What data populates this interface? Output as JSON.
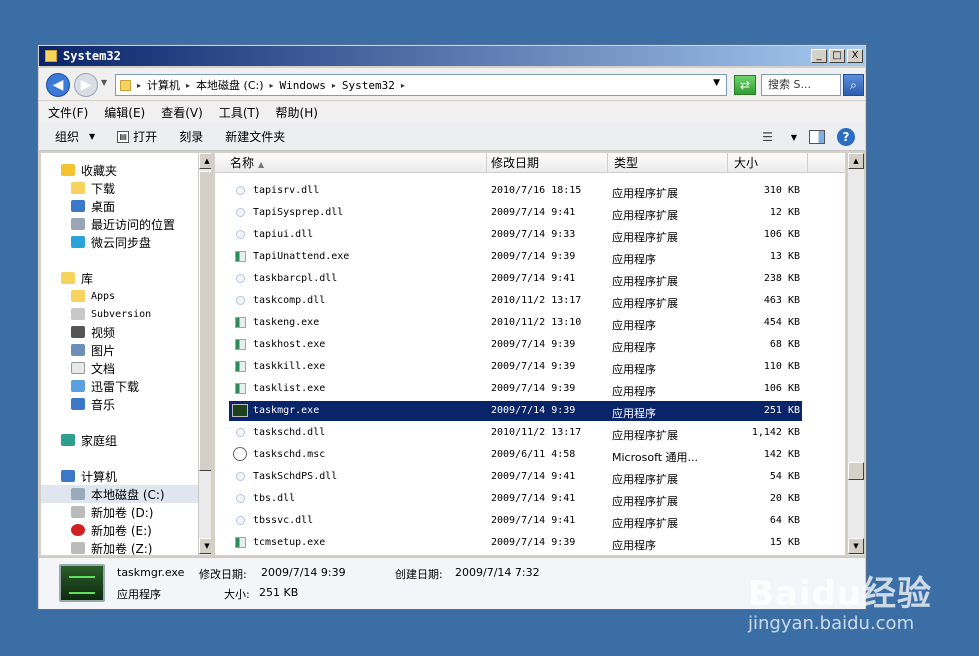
{
  "window": {
    "title": "System32",
    "minimize": "_",
    "maximize": "□",
    "close": "X"
  },
  "address": {
    "breadcrumbs": [
      "计算机",
      "本地磁盘 (C:)",
      "Windows",
      "System32"
    ],
    "search_placeholder": "搜索 S..."
  },
  "menu": [
    "文件(F)",
    "编辑(E)",
    "查看(V)",
    "工具(T)",
    "帮助(H)"
  ],
  "toolbar": {
    "organize": "组织",
    "open": "打开",
    "burn": "刻录",
    "new_folder": "新建文件夹"
  },
  "nav": {
    "favorites": "收藏夹",
    "downloads": "下载",
    "desktop": "桌面",
    "recent": "最近访问的位置",
    "weiyun": "微云同步盘",
    "libraries": "库",
    "apps": "Apps",
    "subversion": "Subversion",
    "videos": "视频",
    "pictures": "图片",
    "documents": "文档",
    "xunlei": "迅雷下载",
    "music": "音乐",
    "homegroup": "家庭组",
    "computer": "计算机",
    "drive_c": "本地磁盘 (C:)",
    "drive_d": "新加卷 (D:)",
    "drive_e": "新加卷 (E:)",
    "drive_z": "新加卷 (Z:)"
  },
  "columns": {
    "name": "名称",
    "date": "修改日期",
    "type": "类型",
    "size": "大小"
  },
  "files": [
    {
      "name": "tapisrv.dll",
      "date": "2010/7/16 18:15",
      "type": "应用程序扩展",
      "size": "310 KB",
      "icon": "dll-icon"
    },
    {
      "name": "TapiSysprep.dll",
      "date": "2009/7/14 9:41",
      "type": "应用程序扩展",
      "size": "12 KB",
      "icon": "dll-icon"
    },
    {
      "name": "tapiui.dll",
      "date": "2009/7/14 9:33",
      "type": "应用程序扩展",
      "size": "106 KB",
      "icon": "dll-icon"
    },
    {
      "name": "TapiUnattend.exe",
      "date": "2009/7/14 9:39",
      "type": "应用程序",
      "size": "13 KB",
      "icon": "exe-icon"
    },
    {
      "name": "taskbarcpl.dll",
      "date": "2009/7/14 9:41",
      "type": "应用程序扩展",
      "size": "238 KB",
      "icon": "dll-icon"
    },
    {
      "name": "taskcomp.dll",
      "date": "2010/11/2 13:17",
      "type": "应用程序扩展",
      "size": "463 KB",
      "icon": "dll-icon"
    },
    {
      "name": "taskeng.exe",
      "date": "2010/11/2 13:10",
      "type": "应用程序",
      "size": "454 KB",
      "icon": "exe-icon"
    },
    {
      "name": "taskhost.exe",
      "date": "2009/7/14 9:39",
      "type": "应用程序",
      "size": "68 KB",
      "icon": "exe-icon"
    },
    {
      "name": "taskkill.exe",
      "date": "2009/7/14 9:39",
      "type": "应用程序",
      "size": "110 KB",
      "icon": "exe-icon"
    },
    {
      "name": "tasklist.exe",
      "date": "2009/7/14 9:39",
      "type": "应用程序",
      "size": "106 KB",
      "icon": "exe-icon"
    },
    {
      "name": "taskmgr.exe",
      "date": "2009/7/14 9:39",
      "type": "应用程序",
      "size": "251 KB",
      "icon": "taskmgr-icon",
      "selected": true
    },
    {
      "name": "taskschd.dll",
      "date": "2010/11/2 13:17",
      "type": "应用程序扩展",
      "size": "1,142 KB",
      "icon": "dll-icon"
    },
    {
      "name": "taskschd.msc",
      "date": "2009/6/11 4:58",
      "type": "Microsoft 通用...",
      "size": "142 KB",
      "icon": "msc-icon"
    },
    {
      "name": "TaskSchdPS.dll",
      "date": "2009/7/14 9:41",
      "type": "应用程序扩展",
      "size": "54 KB",
      "icon": "dll-icon"
    },
    {
      "name": "tbs.dll",
      "date": "2009/7/14 9:41",
      "type": "应用程序扩展",
      "size": "20 KB",
      "icon": "dll-icon"
    },
    {
      "name": "tbssvc.dll",
      "date": "2009/7/14 9:41",
      "type": "应用程序扩展",
      "size": "64 KB",
      "icon": "dll-icon"
    },
    {
      "name": "tcmsetup.exe",
      "date": "2009/7/14 9:39",
      "type": "应用程序",
      "size": "15 KB",
      "icon": "exe-icon"
    }
  ],
  "details": {
    "filename": "taskmgr.exe",
    "modified_label": "修改日期:",
    "modified": "2009/7/14 9:39",
    "created_label": "创建日期:",
    "created": "2009/7/14 7:32",
    "type": "应用程序",
    "size_label": "大小:",
    "size": "251 KB"
  },
  "watermark": {
    "brand": "Baidu经验",
    "url": "jingyan.baidu.com"
  }
}
